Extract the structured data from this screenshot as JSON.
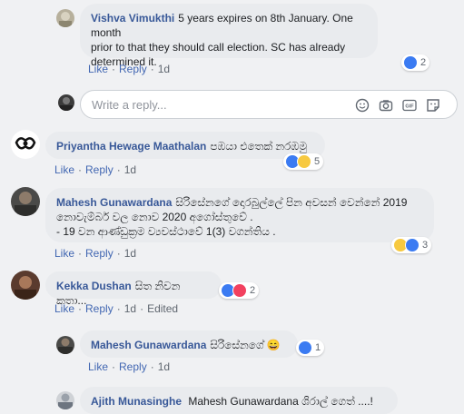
{
  "comments": [
    {
      "author": "Vishva Vimukthi",
      "line1": "5 years expires on 8th January. One month",
      "line2": "prior to that they should call election. SC has already",
      "line3": "determined it.",
      "actions": {
        "like": "Like",
        "reply": "Reply",
        "time": "1d"
      },
      "reactions": {
        "count": "2",
        "types": [
          "like"
        ]
      }
    },
    {
      "author": "Priyantha Hewage Maathalan",
      "text": "පඹයා එතෙක් නරඹමු",
      "actions": {
        "like": "Like",
        "reply": "Reply",
        "time": "1d"
      },
      "reactions": {
        "count": "5",
        "types": [
          "like",
          "haha"
        ]
      }
    },
    {
      "author": "Mahesh Gunawardana",
      "line1": "සිරිසේනගේ දොරබුල්ලේ පින අවසන් වෙන්නේ 2019",
      "line2": "නොවැම්බර් වල නොව 2020 අගෝස්තුවේ .",
      "line3": "- 19 වන ආණ්ඩුක්‍රම ව්‍යවස්ථාවේ 1(3) වගන්තිය .",
      "actions": {
        "like": "Like",
        "reply": "Reply",
        "time": "1d"
      },
      "reactions": {
        "count": "3",
        "types": [
          "haha",
          "like"
        ]
      }
    },
    {
      "author": "Kekka Dushan",
      "text": "සිත නිවන කතා...",
      "actions": {
        "like": "Like",
        "reply": "Reply",
        "time": "1d",
        "edited": "Edited"
      },
      "reactions": {
        "count": "2",
        "types": [
          "like",
          "love"
        ]
      }
    },
    {
      "author": "Mahesh Gunawardana",
      "text": "සිරිසේනගේ 😄",
      "actions": {
        "like": "Like",
        "reply": "Reply",
        "time": "1d"
      },
      "reactions": {
        "count": "1",
        "types": [
          "like"
        ]
      }
    },
    {
      "author": "Ajith Munasinghe",
      "text": "Mahesh Gunawardana ශිරාල් ගෙත් ....!"
    }
  ],
  "reply_box": {
    "placeholder": "Write a reply..."
  },
  "icons": [
    "emoji-icon",
    "camera-icon",
    "gif-icon",
    "sticker-icon"
  ],
  "colors": {
    "link": "#385898",
    "like": "#3b7bf2",
    "bubble": "#e9ebee"
  }
}
